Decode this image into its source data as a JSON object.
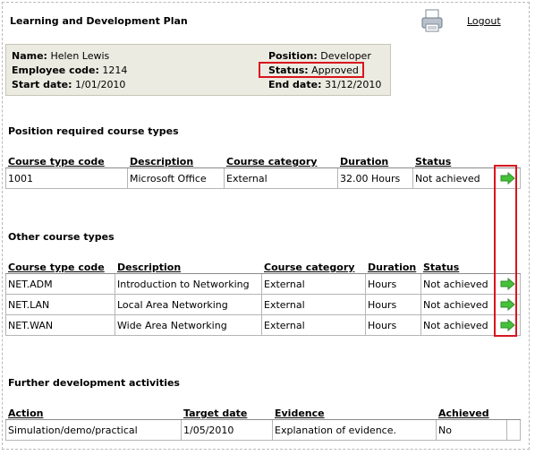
{
  "header": {
    "title": "Learning and Development Plan",
    "logout_label": "Logout",
    "print_icon": "printer-icon"
  },
  "employee": {
    "name_label": "Name:",
    "name_value": "Helen Lewis",
    "code_label": "Employee code:",
    "code_value": "1214",
    "start_label": "Start date:",
    "start_value": "1/01/2010",
    "position_label": "Position:",
    "position_value": "Developer",
    "status_label": "Status:",
    "status_value": "Approved",
    "end_label": "End date:",
    "end_value": "31/12/2010"
  },
  "required": {
    "title": "Position required course types",
    "columns": [
      "Course type code",
      "Description",
      "Course category",
      "Duration",
      "Status"
    ],
    "rows": [
      {
        "code": "1001",
        "description": "Microsoft Office",
        "category": "External",
        "duration": "32.00 Hours",
        "status": "Not achieved"
      }
    ]
  },
  "other": {
    "title": "Other course types",
    "columns": [
      "Course type code",
      "Description",
      "Course category",
      "Duration",
      "Status"
    ],
    "rows": [
      {
        "code": "NET.ADM",
        "description": "Introduction to Networking",
        "category": "External",
        "duration": "Hours",
        "status": "Not achieved"
      },
      {
        "code": "NET.LAN",
        "description": "Local Area Networking",
        "category": "External",
        "duration": "Hours",
        "status": "Not achieved"
      },
      {
        "code": "NET.WAN",
        "description": "Wide Area Networking",
        "category": "External",
        "duration": "Hours",
        "status": "Not achieved"
      }
    ]
  },
  "further": {
    "title": "Further development activities",
    "columns": [
      "Action",
      "Target date",
      "Evidence",
      "Achieved"
    ],
    "rows": [
      {
        "action": "Simulation/demo/practical",
        "target": "1/05/2010",
        "evidence": "Explanation of evidence.",
        "achieved": "No"
      }
    ]
  },
  "colors": {
    "highlight": "#d8151f",
    "info_bg": "#ecebe1",
    "arrow_green": "#45c13a"
  }
}
